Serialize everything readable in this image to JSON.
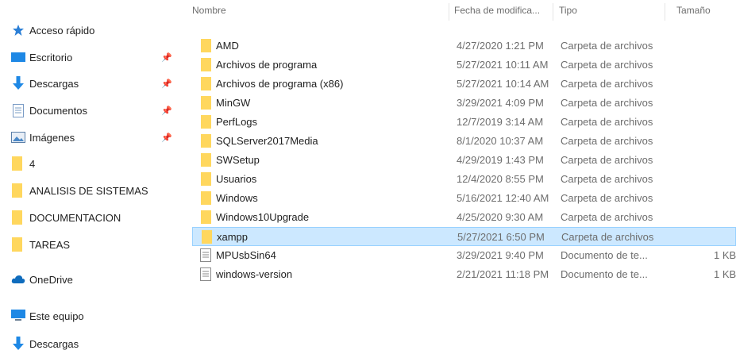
{
  "sidebar": {
    "quick_access": "Acceso rápido",
    "pinned": [
      {
        "label": "Escritorio",
        "icon": "desktop-icon"
      },
      {
        "label": "Descargas",
        "icon": "download-icon"
      },
      {
        "label": "Documentos",
        "icon": "document-icon"
      },
      {
        "label": "Imágenes",
        "icon": "pictures-icon"
      }
    ],
    "folders": [
      "4",
      "ANALISIS DE SISTEMAS",
      "DOCUMENTACION",
      "TAREAS"
    ],
    "onedrive": "OneDrive",
    "this_pc": "Este equipo",
    "this_pc_downloads": "Descargas"
  },
  "columns": {
    "name": "Nombre",
    "date": "Fecha de modifica...",
    "type": "Tipo",
    "size": "Tamaño"
  },
  "files": [
    {
      "name": "AMD",
      "date": "4/27/2020 1:21 PM",
      "type": "Carpeta de archivos",
      "size": "",
      "kind": "folder"
    },
    {
      "name": "Archivos de programa",
      "date": "5/27/2021 10:11 AM",
      "type": "Carpeta de archivos",
      "size": "",
      "kind": "folder"
    },
    {
      "name": "Archivos de programa (x86)",
      "date": "5/27/2021 10:14 AM",
      "type": "Carpeta de archivos",
      "size": "",
      "kind": "folder"
    },
    {
      "name": "MinGW",
      "date": "3/29/2021 4:09 PM",
      "type": "Carpeta de archivos",
      "size": "",
      "kind": "folder"
    },
    {
      "name": "PerfLogs",
      "date": "12/7/2019 3:14 AM",
      "type": "Carpeta de archivos",
      "size": "",
      "kind": "folder"
    },
    {
      "name": "SQLServer2017Media",
      "date": "8/1/2020 10:37 AM",
      "type": "Carpeta de archivos",
      "size": "",
      "kind": "folder"
    },
    {
      "name": "SWSetup",
      "date": "4/29/2019 1:43 PM",
      "type": "Carpeta de archivos",
      "size": "",
      "kind": "folder"
    },
    {
      "name": "Usuarios",
      "date": "12/4/2020 8:55 PM",
      "type": "Carpeta de archivos",
      "size": "",
      "kind": "folder"
    },
    {
      "name": "Windows",
      "date": "5/16/2021 12:40 AM",
      "type": "Carpeta de archivos",
      "size": "",
      "kind": "folder"
    },
    {
      "name": "Windows10Upgrade",
      "date": "4/25/2020 9:30 AM",
      "type": "Carpeta de archivos",
      "size": "",
      "kind": "folder"
    },
    {
      "name": "xampp",
      "date": "5/27/2021 6:50 PM",
      "type": "Carpeta de archivos",
      "size": "",
      "kind": "folder",
      "selected": true
    },
    {
      "name": "MPUsbSin64",
      "date": "3/29/2021 9:40 PM",
      "type": "Documento de te...",
      "size": "1 KB",
      "kind": "text"
    },
    {
      "name": "windows-version",
      "date": "2/21/2021 11:18 PM",
      "type": "Documento de te...",
      "size": "1 KB",
      "kind": "text"
    }
  ],
  "colors": {
    "selection_bg": "#cce8ff",
    "selection_border": "#99d1ff",
    "folder": "#ffd75e",
    "accent_blue": "#1e88e5"
  }
}
